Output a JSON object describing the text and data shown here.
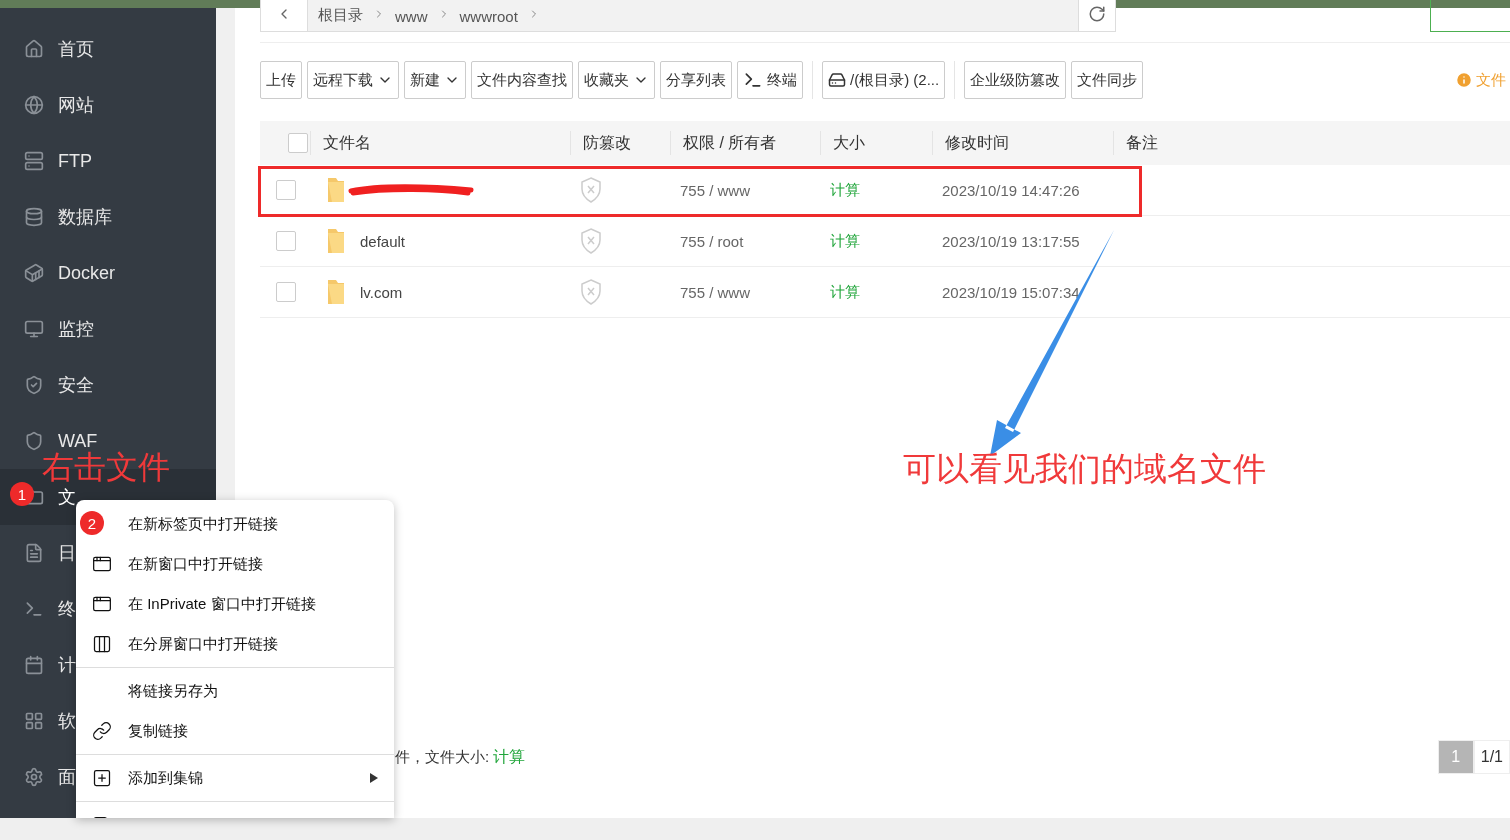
{
  "sidebar": {
    "items": [
      {
        "label": "首页",
        "selected": false
      },
      {
        "label": "网站",
        "selected": false
      },
      {
        "label": "FTP",
        "selected": false
      },
      {
        "label": "数据库",
        "selected": false
      },
      {
        "label": "Docker",
        "selected": false
      },
      {
        "label": "监控",
        "selected": false
      },
      {
        "label": "安全",
        "selected": false
      },
      {
        "label": "WAF",
        "selected": false
      },
      {
        "label": "文",
        "selected": true
      },
      {
        "label": "日",
        "selected": false
      },
      {
        "label": "终",
        "selected": false
      },
      {
        "label": "计",
        "selected": false
      },
      {
        "label": "软",
        "selected": false
      },
      {
        "label": "面",
        "selected": false
      }
    ]
  },
  "breadcrumb": [
    "根目录",
    "www",
    "wwwroot"
  ],
  "toolbar": {
    "groups": [
      [
        {
          "label": "上传",
          "dropdown": false,
          "kind": "text"
        },
        {
          "label": "远程下载",
          "dropdown": true,
          "kind": "text"
        },
        {
          "label": "新建",
          "dropdown": true,
          "kind": "text"
        },
        {
          "label": "文件内容查找",
          "dropdown": false,
          "kind": "text"
        },
        {
          "label": "收藏夹",
          "dropdown": true,
          "kind": "text"
        },
        {
          "label": "分享列表",
          "dropdown": false,
          "kind": "text"
        },
        {
          "label": "终端",
          "dropdown": false,
          "kind": "terminal"
        }
      ],
      [
        {
          "label": "/(根目录) (2...",
          "dropdown": false,
          "kind": "disk"
        }
      ],
      [
        {
          "label": "企业级防篡改",
          "dropdown": false,
          "kind": "text"
        },
        {
          "label": "文件同步",
          "dropdown": false,
          "kind": "text"
        }
      ]
    ],
    "notice": "文件"
  },
  "table": {
    "header_checked": false,
    "columns": [
      "文件名",
      "防篡改",
      "权限 / 所有者",
      "大小",
      "修改时间",
      "备注"
    ],
    "rows": [
      {
        "name": null,
        "redacted": true,
        "checked": false,
        "permission": "755 / www",
        "size": "计算",
        "modified": "2023/10/19 14:47:26"
      },
      {
        "name": "default",
        "redacted": false,
        "checked": false,
        "permission": "755 / root",
        "size": "计算",
        "modified": "2023/10/19 13:17:55"
      },
      {
        "name": "lv.com",
        "redacted": false,
        "checked": false,
        "permission": "755 / www",
        "size": "计算",
        "modified": "2023/10/19 15:07:34"
      }
    ]
  },
  "footer": {
    "summary": "件，文件大小:",
    "size": "计算",
    "pages": [
      {
        "label": "1",
        "selected": true
      },
      {
        "label": "1/1",
        "selected": false
      }
    ]
  },
  "context_menu": {
    "groups": [
      [
        {
          "label": "在新标签页中打开链接",
          "submenu": false
        },
        {
          "label": "在新窗口中打开链接",
          "submenu": false
        },
        {
          "label": "在 InPrivate 窗口中打开链接",
          "submenu": false
        },
        {
          "label": "在分屏窗口中打开链接",
          "submenu": false
        }
      ],
      [
        {
          "label": "将链接另存为",
          "submenu": false
        },
        {
          "label": "复制链接",
          "submenu": false
        }
      ],
      [
        {
          "label": "添加到集锦",
          "submenu": true
        }
      ]
    ]
  },
  "annotations": {
    "step_label": "右击文件",
    "caption": "可以看见我们的域名文件",
    "badges": [
      "1",
      "2"
    ]
  }
}
